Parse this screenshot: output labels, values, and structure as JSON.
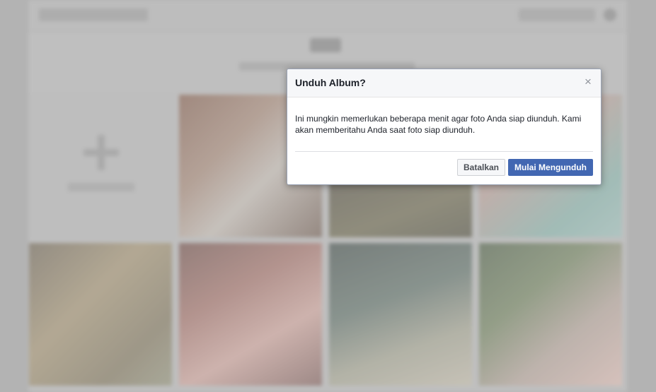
{
  "dialog": {
    "title": "Unduh Album?",
    "close_symbol": "×",
    "body": "Ini mungkin memerlukan beberapa menit agar foto Anda siap diunduh. Kami akan memberitahu Anda saat foto siap diunduh.",
    "cancel_label": "Batalkan",
    "confirm_label": "Mulai Mengunduh"
  },
  "colors": {
    "primary_button": "#4267b2",
    "overlay": "#8b8b8b"
  },
  "icons": {
    "close": "close-icon",
    "settings": "gear-icon",
    "add_photos": "plus-icon"
  }
}
